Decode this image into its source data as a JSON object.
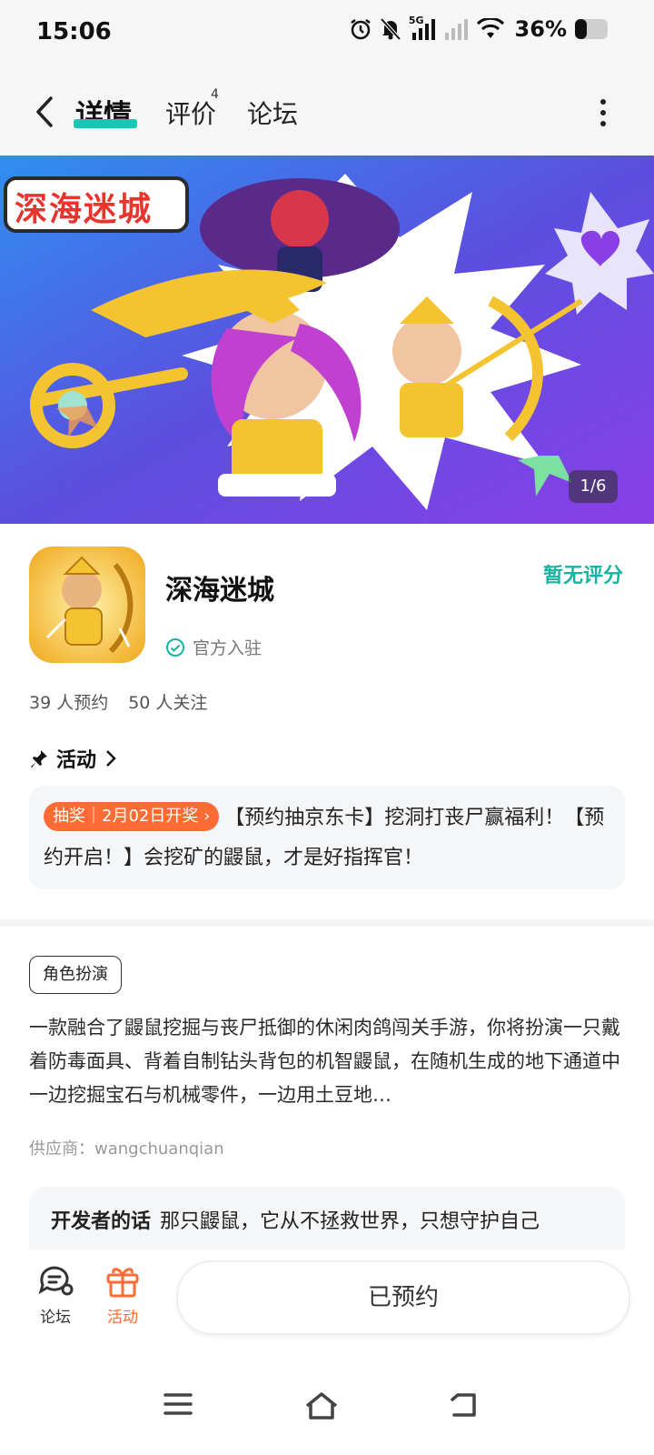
{
  "status_bar": {
    "time": "15:06",
    "network": "5G",
    "battery": "36%"
  },
  "nav": {
    "tabs": [
      {
        "label": "详情"
      },
      {
        "label": "评价",
        "badge": "4"
      },
      {
        "label": "论坛"
      }
    ]
  },
  "banner": {
    "title": "深海迷城",
    "counter": "1/6"
  },
  "app": {
    "name": "深海迷城",
    "verified": "官方入驻",
    "rating": "暂无评分",
    "reservations": "39 人预约",
    "followers": "50 人关注"
  },
  "activity": {
    "heading": "活动",
    "tag": "抽奖｜2月02日开奖",
    "text": "【预约抽京东卡】挖洞打丧尸赢福利！【预约开启！】会挖矿的鼹鼠，才是好指挥官！"
  },
  "info": {
    "genre": "角色扮演",
    "description": "一款融合了鼹鼠挖掘与丧尸抵御的休闲肉鸽闯关手游，你将扮演一只戴着防毒面具、背着自制钻头背包的机智鼹鼠，在随机生成的地下通道中一边挖掘宝石与机械零件，一边用土豆地…",
    "supplier": "供应商：wangchuanqian"
  },
  "developer": {
    "label": "开发者的话",
    "text": "那只鼹鼠，它从不拯救世界，只想守护自己"
  },
  "bottom_bar": {
    "forum": "论坛",
    "activity": "活动",
    "reserve": "已预约"
  },
  "colors": {
    "accent": "#18c6b3",
    "orange": "#ff6b35",
    "rating": "#19b3a3"
  }
}
